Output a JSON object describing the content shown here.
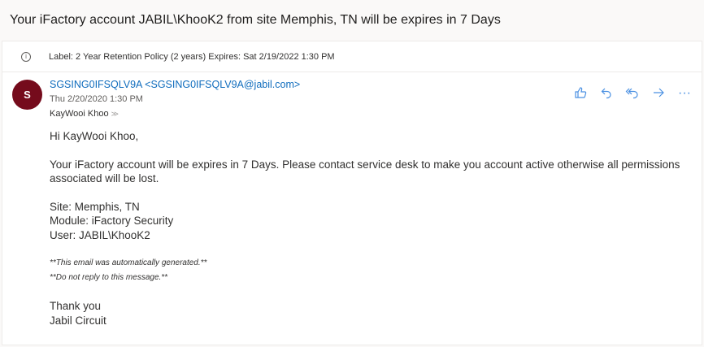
{
  "subject": "Your iFactory account JABIL\\KhooK2 from site Memphis, TN will be expires in 7 Days",
  "label": "Label: 2 Year Retention Policy (2 years) Expires: Sat 2/19/2022 1:30 PM",
  "sender": {
    "initial": "S",
    "display": "SGSING0IFSQLV9A <SGSING0IFSQLV9A@jabil.com>",
    "avatar_color": "#750b1c"
  },
  "date": "Thu 2/20/2020 1:30 PM",
  "to": "KayWooi Khoo",
  "actions": {
    "like": "👍",
    "reply": "↶",
    "reply_all": "«",
    "forward": "→",
    "more": "···"
  },
  "body": {
    "greeting": "Hi KayWooi Khoo,",
    "paragraph": "Your iFactory account will be expires in 7 Days. Please contact service desk to make you account active otherwise all permissions associated will be lost.",
    "site": "Site: Memphis, TN",
    "module": "Module: iFactory Security",
    "user": "User: JABIL\\KhooK2",
    "note1": "**This email was automatically generated.**",
    "note2": "**Do not reply to this message.**",
    "thanks": "Thank you",
    "signature": "Jabil Circuit"
  }
}
